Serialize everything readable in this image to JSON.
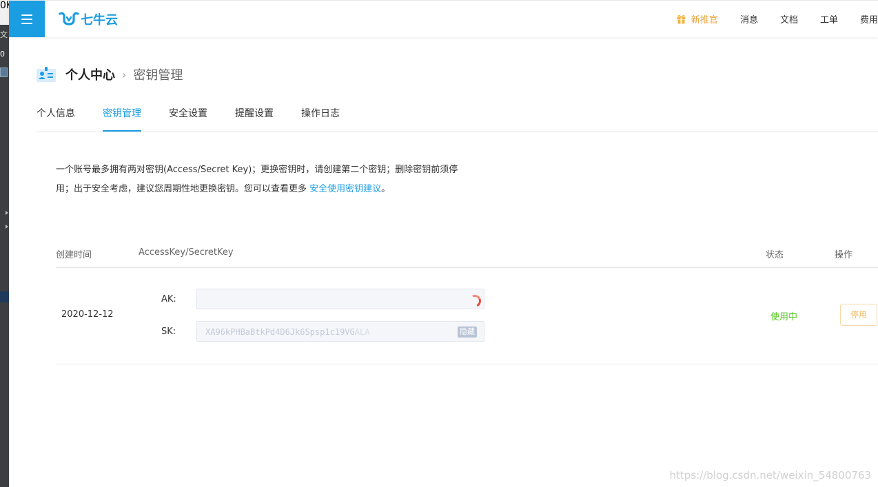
{
  "edge": {
    "text_1": "0K",
    "text_2": "文",
    "text_3": "0"
  },
  "topbar": {
    "logo_text": "七牛云",
    "colors": {
      "brand": "#1a9de1",
      "promo": "#e6a23c"
    },
    "nav": [
      {
        "label": "新推官",
        "icon": "gift-icon"
      },
      {
        "label": "消息"
      },
      {
        "label": "文档"
      },
      {
        "label": "工单"
      },
      {
        "label": "费用"
      }
    ]
  },
  "header": {
    "root": "个人中心",
    "current": "密钥管理",
    "icon": "id-card-icon"
  },
  "tabs": [
    {
      "label": "个人信息",
      "active": false
    },
    {
      "label": "密钥管理",
      "active": true
    },
    {
      "label": "安全设置",
      "active": false
    },
    {
      "label": "提醒设置",
      "active": false
    },
    {
      "label": "操作日志",
      "active": false
    }
  ],
  "description": {
    "line1": "一个账号最多拥有两对密钥(Access/Secret Key)；更换密钥时，请创建第二个密钥；删除密钥前须停",
    "line2_prefix": "用；出于安全考虑，建议您周期性地更换密钥。您可以查看更多 ",
    "link": "安全使用密钥建议",
    "line2_suffix": "。"
  },
  "table": {
    "columns": [
      "创建时间",
      "AccessKey/SecretKey",
      "状态",
      "操作"
    ],
    "rows": [
      {
        "date": "2020-12-12",
        "ak_label": "AK:",
        "ak_value": "",
        "sk_label": "SK:",
        "sk_value": "XA96kPHBaBtkPd4D6Jk6Spsp1c19VGALA",
        "hide_label": "隐藏",
        "status": "使用中",
        "action": "停用"
      }
    ]
  },
  "watermark": "https://blog.csdn.net/weixin_54800763"
}
